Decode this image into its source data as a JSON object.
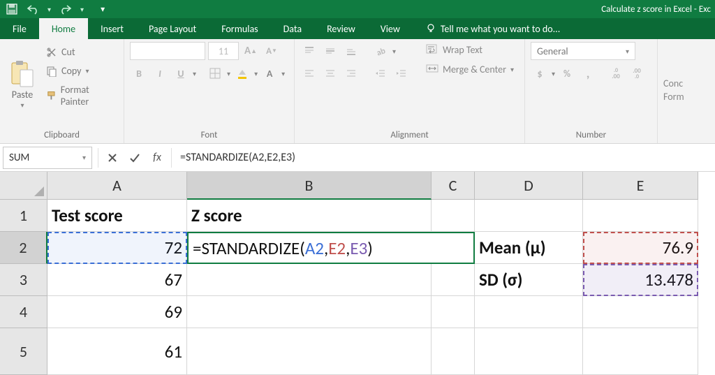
{
  "titlebar": {
    "title": "Calculate z score in Excel - Exc"
  },
  "tabs": {
    "file": "File",
    "home": "Home",
    "insert": "Insert",
    "page_layout": "Page Layout",
    "formulas": "Formulas",
    "data": "Data",
    "review": "Review",
    "view": "View",
    "tell_me": "Tell me what you want to do..."
  },
  "clipboard": {
    "paste": "Paste",
    "cut": "Cut",
    "copy": "Copy",
    "format_painter": "Format Painter",
    "group_label": "Clipboard"
  },
  "font": {
    "size_value": "11",
    "group_label": "Font",
    "b": "B",
    "i": "I",
    "u": "U"
  },
  "alignment": {
    "wrap_text": "Wrap Text",
    "merge_center": "Merge & Center",
    "group_label": "Alignment"
  },
  "number": {
    "format_value": "General",
    "group_label": "Number",
    "currency": "$",
    "percent": "%",
    "comma": ",",
    "inc": ".0",
    "inc2": ".00",
    "dec": ".0",
    "dec2": ".00"
  },
  "cells": {
    "cond": "Conc",
    "format": "Form"
  },
  "formulabar": {
    "namebox_value": "SUM",
    "fx": "fx",
    "formula_value": "=STANDARDIZE(A2,E2,E3)"
  },
  "grid": {
    "cols": [
      "A",
      "B",
      "C",
      "D",
      "E"
    ],
    "rows": [
      "1",
      "2",
      "3",
      "4",
      "5"
    ],
    "data": {
      "A1": "Test score",
      "B1": "Z score",
      "A2": "72",
      "B2_edit": "=STANDARDIZE(",
      "B2_r1": "A2",
      "B2_c1": ",",
      "B2_r2": "E2",
      "B2_c2": ",",
      "B2_r3": "E3",
      "B2_end": ")",
      "D2": "Mean (μ)",
      "E2": "76.9",
      "A3": "67",
      "D3": "SD (σ)",
      "E3": "13.478",
      "A4": "69",
      "A5": "61"
    }
  }
}
